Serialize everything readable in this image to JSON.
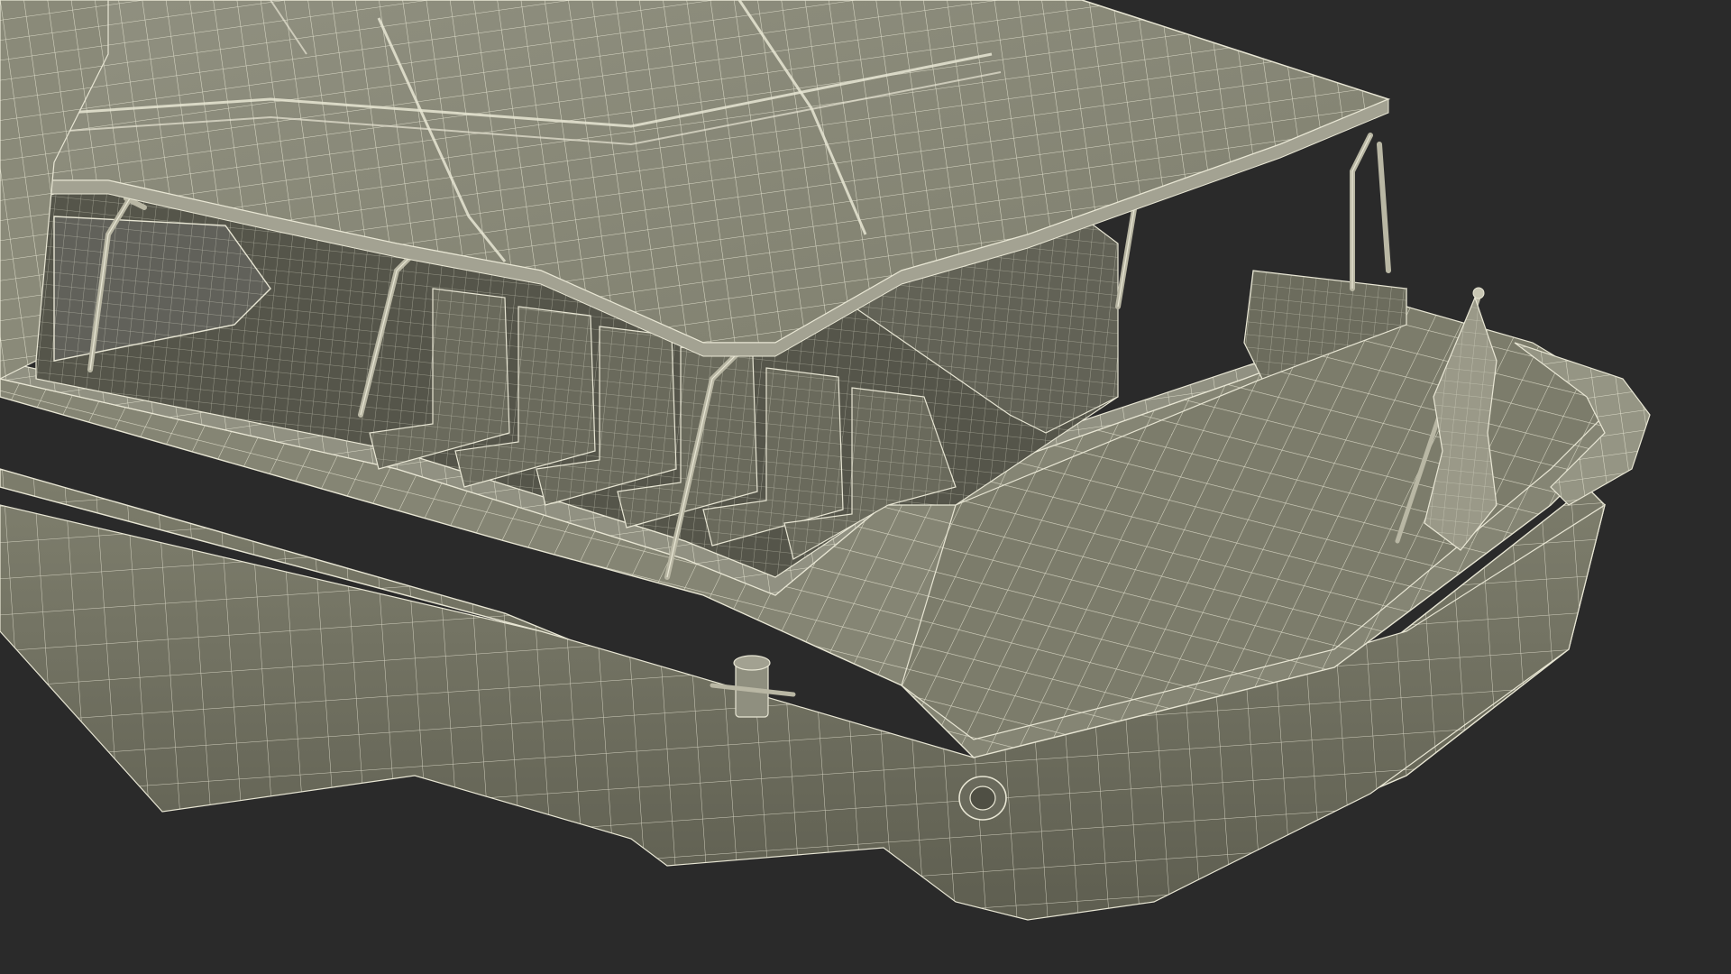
{
  "scene": {
    "subject": "boat-wireframe-render",
    "colors": {
      "background": "#2a2a2a",
      "surface_light": "#8c8c7c",
      "surface_mid": "#7a7a6a",
      "surface_dark": "#5e5e50",
      "interior": "#56564a",
      "wire": "#e8e6d4"
    }
  }
}
